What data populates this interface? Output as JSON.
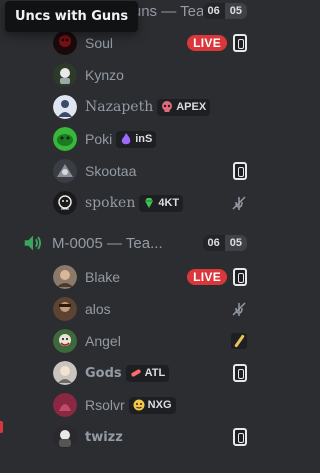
{
  "tooltip": {
    "text": "Uncs with Guns"
  },
  "channels": [
    {
      "name": "Uncs with Guns — Tea...",
      "users": "06",
      "limit": "05"
    },
    {
      "name": "M-0005 — Tea...",
      "users": "06",
      "limit": "05"
    }
  ],
  "colors": {
    "live": "#da373c",
    "speaker": "#3ba55d",
    "background": "#2b2d31"
  },
  "members": [
    {
      "name": "Soul",
      "avatar_color": "#7a0f14",
      "live": "LIVE",
      "icon": "r6-icon"
    },
    {
      "name": "Kynzo",
      "avatar_color": "#2d3a2a"
    },
    {
      "name": "Nazapeth",
      "avatar_color": "#3b4a6b",
      "tag": {
        "text": "APEX",
        "icon": "skull-icon",
        "color": "#e36a7a"
      }
    },
    {
      "name": "Poki",
      "avatar_color": "#37b83a",
      "tag": {
        "text": "inS",
        "icon": "flame-icon",
        "color": "#9b6bff"
      }
    },
    {
      "name": "Skootaa",
      "avatar_color": "#3b3d44",
      "icon": "r6-icon"
    },
    {
      "name": "spoken",
      "avatar_color": "#1a1a1a",
      "tag": {
        "text": "4KT",
        "icon": "gem-icon",
        "color": "#43c45a"
      },
      "icon": "muted-icon"
    },
    {
      "name": "Blake",
      "avatar_color": "#6b5a4a",
      "live": "LIVE",
      "icon": "r6-icon"
    },
    {
      "name": "alos",
      "avatar_color": "#5b4434",
      "icon": "muted-icon"
    },
    {
      "name": "Angel",
      "avatar_color": "#3d6a3a",
      "icon": "pen-icon"
    },
    {
      "name": "Gods",
      "avatar_color": "#c9c4bf",
      "tag": {
        "text": "ATL",
        "icon": "pill-icon",
        "color": "#ff6a6a"
      },
      "icon": "r6-icon"
    },
    {
      "name": "Rsolvr",
      "avatar_color": "#8a2844",
      "tag": {
        "text": "NXG",
        "icon": "face-icon",
        "color": "#f6c945"
      }
    },
    {
      "name": "twizz",
      "avatar_color": "#2a2a2e",
      "icon": "r6-icon"
    }
  ]
}
